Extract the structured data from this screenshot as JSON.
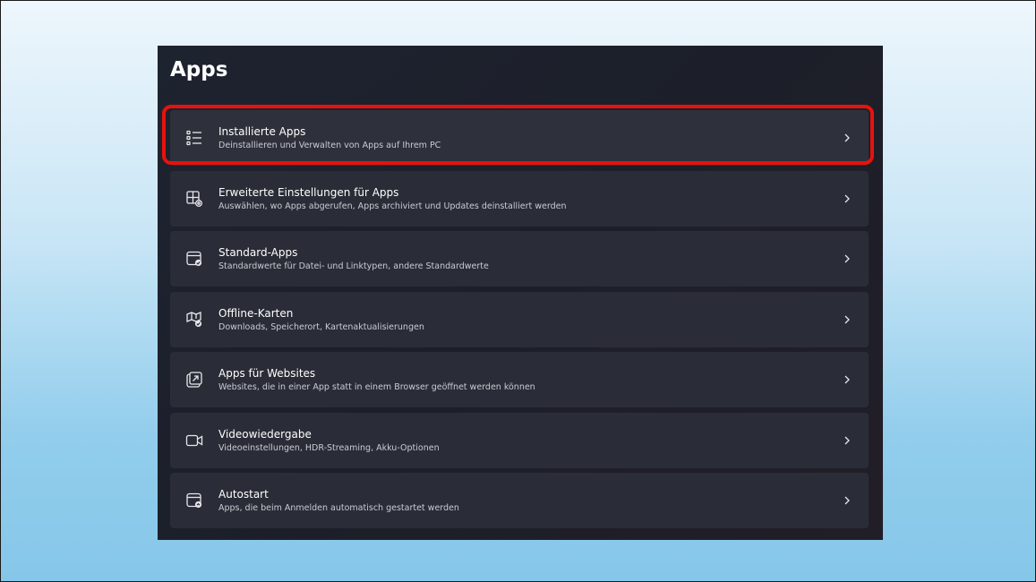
{
  "page": {
    "title": "Apps"
  },
  "items": [
    {
      "label": "Installierte Apps",
      "description": "Deinstallieren und Verwalten von Apps auf Ihrem PC",
      "icon": "app-list-icon"
    },
    {
      "label": "Erweiterte Einstellungen für Apps",
      "description": "Auswählen, wo Apps abgerufen, Apps archiviert und Updates deinstalliert werden",
      "icon": "app-settings-icon"
    },
    {
      "label": "Standard-Apps",
      "description": "Standardwerte für Datei- und Linktypen, andere Standardwerte",
      "icon": "default-apps-icon"
    },
    {
      "label": "Offline-Karten",
      "description": "Downloads, Speicherort, Kartenaktualisierungen",
      "icon": "map-download-icon"
    },
    {
      "label": "Apps für Websites",
      "description": "Websites, die in einer App statt in einem Browser geöffnet werden können",
      "icon": "open-external-icon"
    },
    {
      "label": "Videowiedergabe",
      "description": "Videoeinstellungen, HDR-Streaming, Akku-Optionen",
      "icon": "video-camera-icon"
    },
    {
      "label": "Autostart",
      "description": "Apps, die beim Anmelden automatisch gestartet werden",
      "icon": "startup-icon"
    }
  ],
  "colors": {
    "callout": "#e8120c",
    "window_bg": "#1c1f29",
    "card_bg": "#2a2d37"
  }
}
